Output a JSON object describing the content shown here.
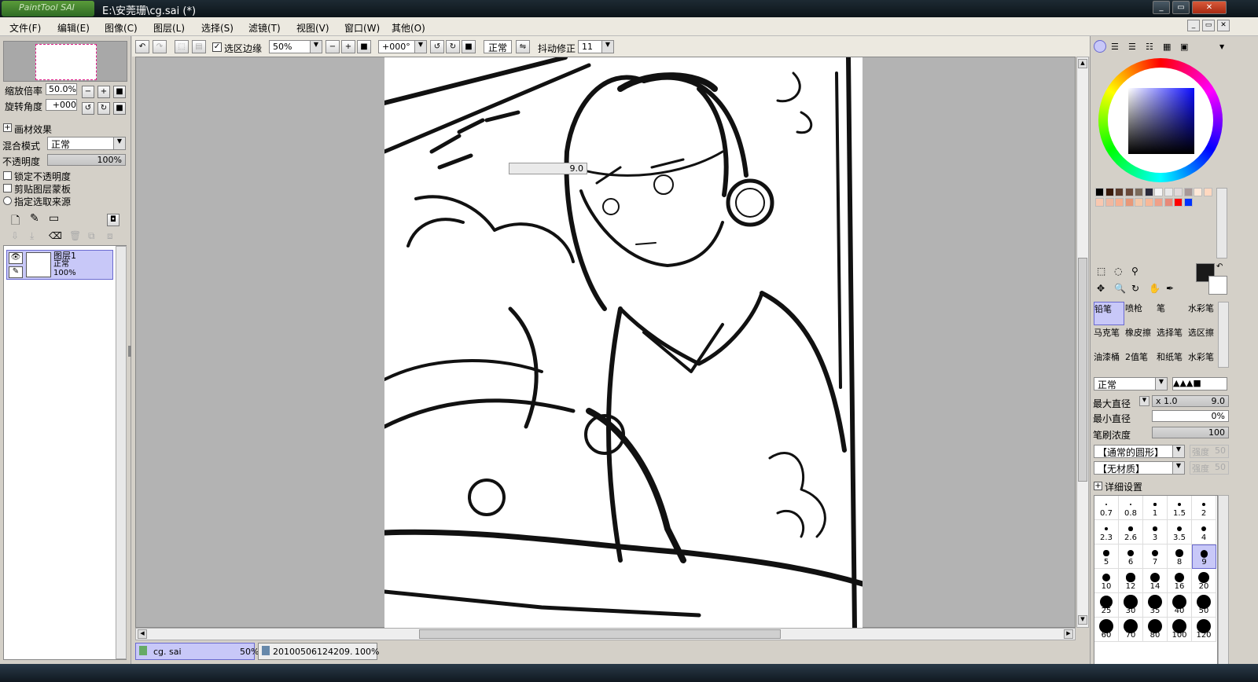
{
  "app": {
    "logo_text": "PaintTool SAI",
    "title": "E:\\安莞珊\\cg.sai (*)",
    "window_buttons": [
      "minimize-icon",
      "restore-icon",
      "close-icon"
    ]
  },
  "menu": {
    "items": [
      "文件(F)",
      "编辑(E)",
      "图像(C)",
      "图层(L)",
      "选择(S)",
      "滤镜(T)",
      "视图(V)",
      "窗口(W)",
      "其他(O)"
    ]
  },
  "navigator": {
    "zoom_label": "缩放倍率",
    "zoom_value": "50.0%",
    "rotate_label": "旋转角度",
    "rotate_value": "+000"
  },
  "layer_props": {
    "effects_label": "画材效果",
    "blend_label": "混合模式",
    "blend_value": "正常",
    "opacity_label": "不透明度",
    "opacity_value": "100%",
    "opacity_fraction": 1.0,
    "lock_opacity": "锁定不透明度",
    "clip_mask": "剪贴图层蒙板",
    "selection_source": "指定选取来源"
  },
  "layers": [
    {
      "name": "图层1",
      "mode": "正常",
      "opacity": "100%"
    }
  ],
  "toolbar": {
    "selection_edge_label": "选区边缘",
    "selection_edge_checked": true,
    "zoom": "50%",
    "rotation": "+000°",
    "mode": "正常",
    "stabilizer_label": "抖动修正",
    "stabilizer_value": "11"
  },
  "canvas": {
    "brush_size_tip": "9.0",
    "paper_color": "#ffffff",
    "background_color": "#b3b3b3"
  },
  "doc_tabs": [
    {
      "name": "cg. sai",
      "zoom": "50%",
      "active": true
    },
    {
      "name": "20100506124209. . .",
      "zoom": "100%",
      "active": false
    }
  ],
  "tools": {
    "rows": [
      [
        "铅笔",
        "喷枪",
        "笔",
        "水彩笔"
      ],
      [
        "马克笔",
        "橡皮擦",
        "选择笔",
        "选区擦"
      ],
      [
        "油漆桶",
        "2值笔",
        "和纸笔",
        "水彩笔"
      ]
    ],
    "selected": "铅笔",
    "primary_color": "#1a1a1a",
    "secondary_color": "#ffffff"
  },
  "brush": {
    "mode": "正常",
    "max_size_label": "最大直径",
    "max_size_multiplier": "x 1.0",
    "max_size_value": "9.0",
    "min_size_label": "最小直径",
    "min_size_value": "0%",
    "density_label": "笔刷浓度",
    "density_value": "100",
    "shape": "【通常的圆形】",
    "shape_strength_label": "强度",
    "shape_strength_value": "50",
    "texture": "【无材质】",
    "texture_strength_label": "强度",
    "texture_strength_value": "50",
    "detail_label": "详细设置"
  },
  "sizes": [
    "0.7",
    "0.8",
    "1",
    "1.5",
    "2",
    "2.3",
    "2.6",
    "3",
    "3.5",
    "4",
    "5",
    "6",
    "7",
    "8",
    "9",
    "10",
    "12",
    "14",
    "16",
    "20",
    "25",
    "30",
    "35",
    "40",
    "50",
    "60",
    "70",
    "80",
    "100",
    "120"
  ],
  "selected_size": "9",
  "swatch_colors": [
    "#000000",
    "#3a1a0a",
    "#5a3a2a",
    "#6a4a3a",
    "#7a6a5a",
    "#2a2a3a",
    "#f5f5f5",
    "#e8e8e8",
    "#e0d8d8",
    "#a89898",
    "#ffe8d8",
    "#ffd8c0",
    "#f8c8b0",
    "#f0b8a0",
    "#f8b090",
    "#e89878",
    "#f5c8a8",
    "#f8b898",
    "#f0a088",
    "#e88878",
    "#ff0000",
    "#0033ff"
  ]
}
